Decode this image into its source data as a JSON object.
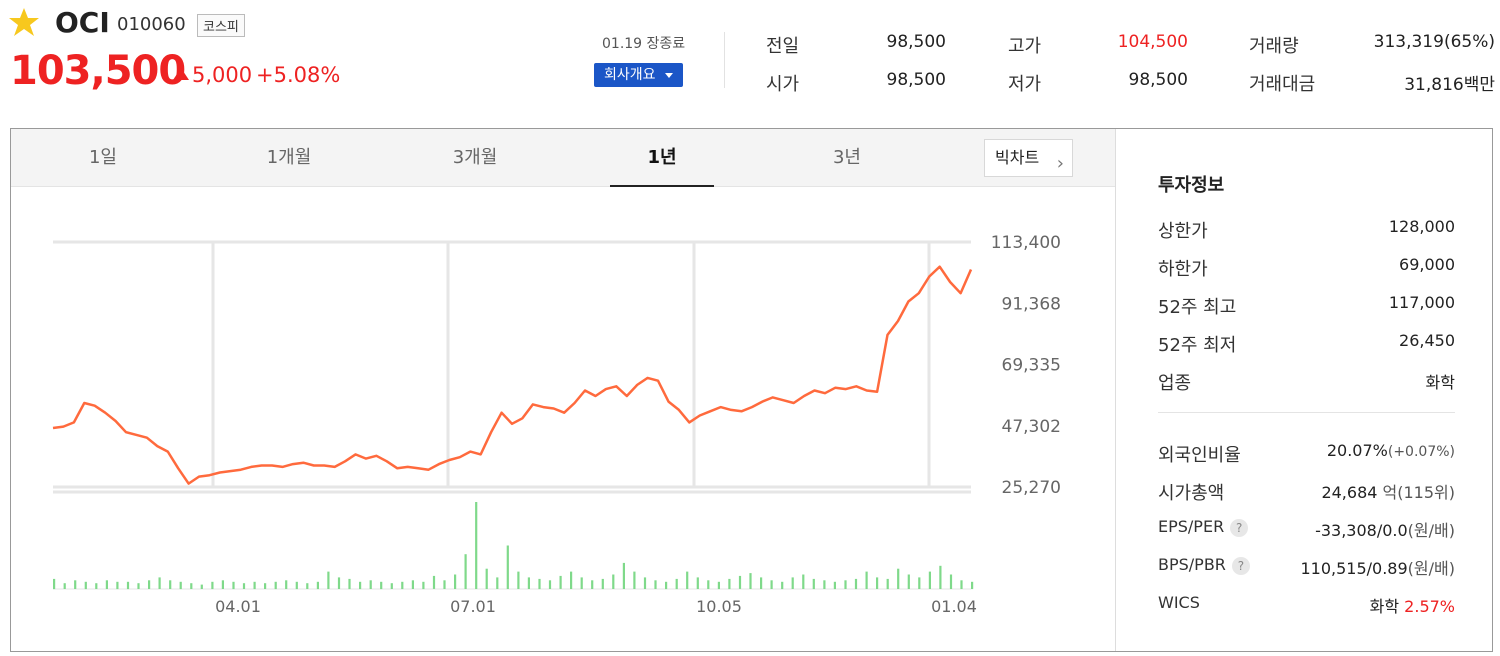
{
  "stock": {
    "name": "OCI",
    "code": "010060",
    "market": "코스피",
    "price": "103,500",
    "change": "5,000",
    "change_rate": "+5.08%",
    "close_date": "01.19 장종료",
    "overview_label": "회사개요"
  },
  "summary": {
    "prev_close_label": "전일",
    "prev_close": "98,500",
    "open_label": "시가",
    "open": "98,500",
    "high_label": "고가",
    "high": "104,500",
    "low_label": "저가",
    "low": "98,500",
    "volume_label": "거래량",
    "volume": "313,319(65%)",
    "value_label": "거래대금",
    "value_num": "31,816",
    "value_unit": "백만"
  },
  "tabs": [
    "1일",
    "1개월",
    "3개월",
    "1년",
    "3년"
  ],
  "active_tab": "1년",
  "bigchart_label": "빅차트",
  "chart_data": {
    "type": "line",
    "title": "",
    "y_ticks": [
      "113,400",
      "91,368",
      "69,335",
      "47,302",
      "25,270"
    ],
    "x_ticks": [
      "04.01",
      "07.01",
      "10.05",
      "01.04"
    ],
    "ylim": [
      25270,
      113400
    ],
    "series": [
      {
        "values": [
          46500,
          47000,
          48500,
          55500,
          54500,
          52000,
          49000,
          45000,
          44000,
          43000,
          40000,
          38000,
          32000,
          26500,
          29000,
          29500,
          30500,
          31000,
          31500,
          32500,
          33000,
          33000,
          32500,
          33500,
          34000,
          33000,
          33000,
          32500,
          34500,
          37000,
          35500,
          36500,
          34500,
          32000,
          32500,
          32000,
          31500,
          33500,
          35000,
          36000,
          38000,
          37000,
          45000,
          52000,
          48000,
          50000,
          55000,
          54000,
          53500,
          52000,
          55500,
          60000,
          58000,
          60500,
          61500,
          58000,
          62000,
          64500,
          63500,
          56000,
          53000,
          48500,
          51000,
          52500,
          54000,
          53000,
          52500,
          54000,
          56000,
          57500,
          56500,
          55500,
          58000,
          60000,
          59000,
          61000,
          60500,
          61500,
          60000,
          59500,
          80000,
          85000,
          92000,
          95000,
          101000,
          104500,
          99000,
          95000,
          103500
        ]
      }
    ],
    "volume": [
      7,
      4,
      6,
      5,
      4,
      6,
      5,
      5,
      4,
      6,
      8,
      6,
      5,
      4,
      3,
      5,
      6,
      5,
      4,
      5,
      4,
      5,
      6,
      5,
      4,
      5,
      12,
      8,
      7,
      5,
      6,
      5,
      4,
      5,
      6,
      5,
      9,
      6,
      10,
      24,
      60,
      14,
      8,
      30,
      12,
      8,
      7,
      6,
      9,
      12,
      8,
      6,
      7,
      10,
      18,
      12,
      8,
      6,
      5,
      7,
      12,
      8,
      6,
      5,
      7,
      9,
      11,
      8,
      6,
      5,
      8,
      10,
      7,
      6,
      5,
      6,
      7,
      12,
      8,
      7,
      14,
      10,
      8,
      12,
      16,
      10,
      6,
      5
    ]
  },
  "info": {
    "title": "투자정보",
    "upper_limit_label": "상한가",
    "upper_limit": "128,000",
    "lower_limit_label": "하한가",
    "lower_limit": "69,000",
    "high52_label": "52주 최고",
    "high52": "117,000",
    "low52_label": "52주 최저",
    "low52": "26,450",
    "sector_label": "업종",
    "sector": "화학",
    "foreign_label": "외국인비율",
    "foreign": "20.07%",
    "foreign_change": "(+0.07%)",
    "mcap_label": "시가총액",
    "mcap": "24,684",
    "mcap_unit": "억",
    "mcap_rank": "(115위)",
    "eps_label": "EPS/PER",
    "eps": "-33,308/0.0",
    "eps_unit": "(원/배)",
    "bps_label": "BPS/PBR",
    "bps": "110,515/0.89",
    "bps_unit": "(원/배)",
    "wics_label": "WICS",
    "wics": "화학",
    "wics_rate": "2.57%"
  },
  "colors": {
    "up": "#e22222",
    "down": "#1b56c7",
    "line": "#ff6a3d",
    "volume": "#7fd98a"
  }
}
